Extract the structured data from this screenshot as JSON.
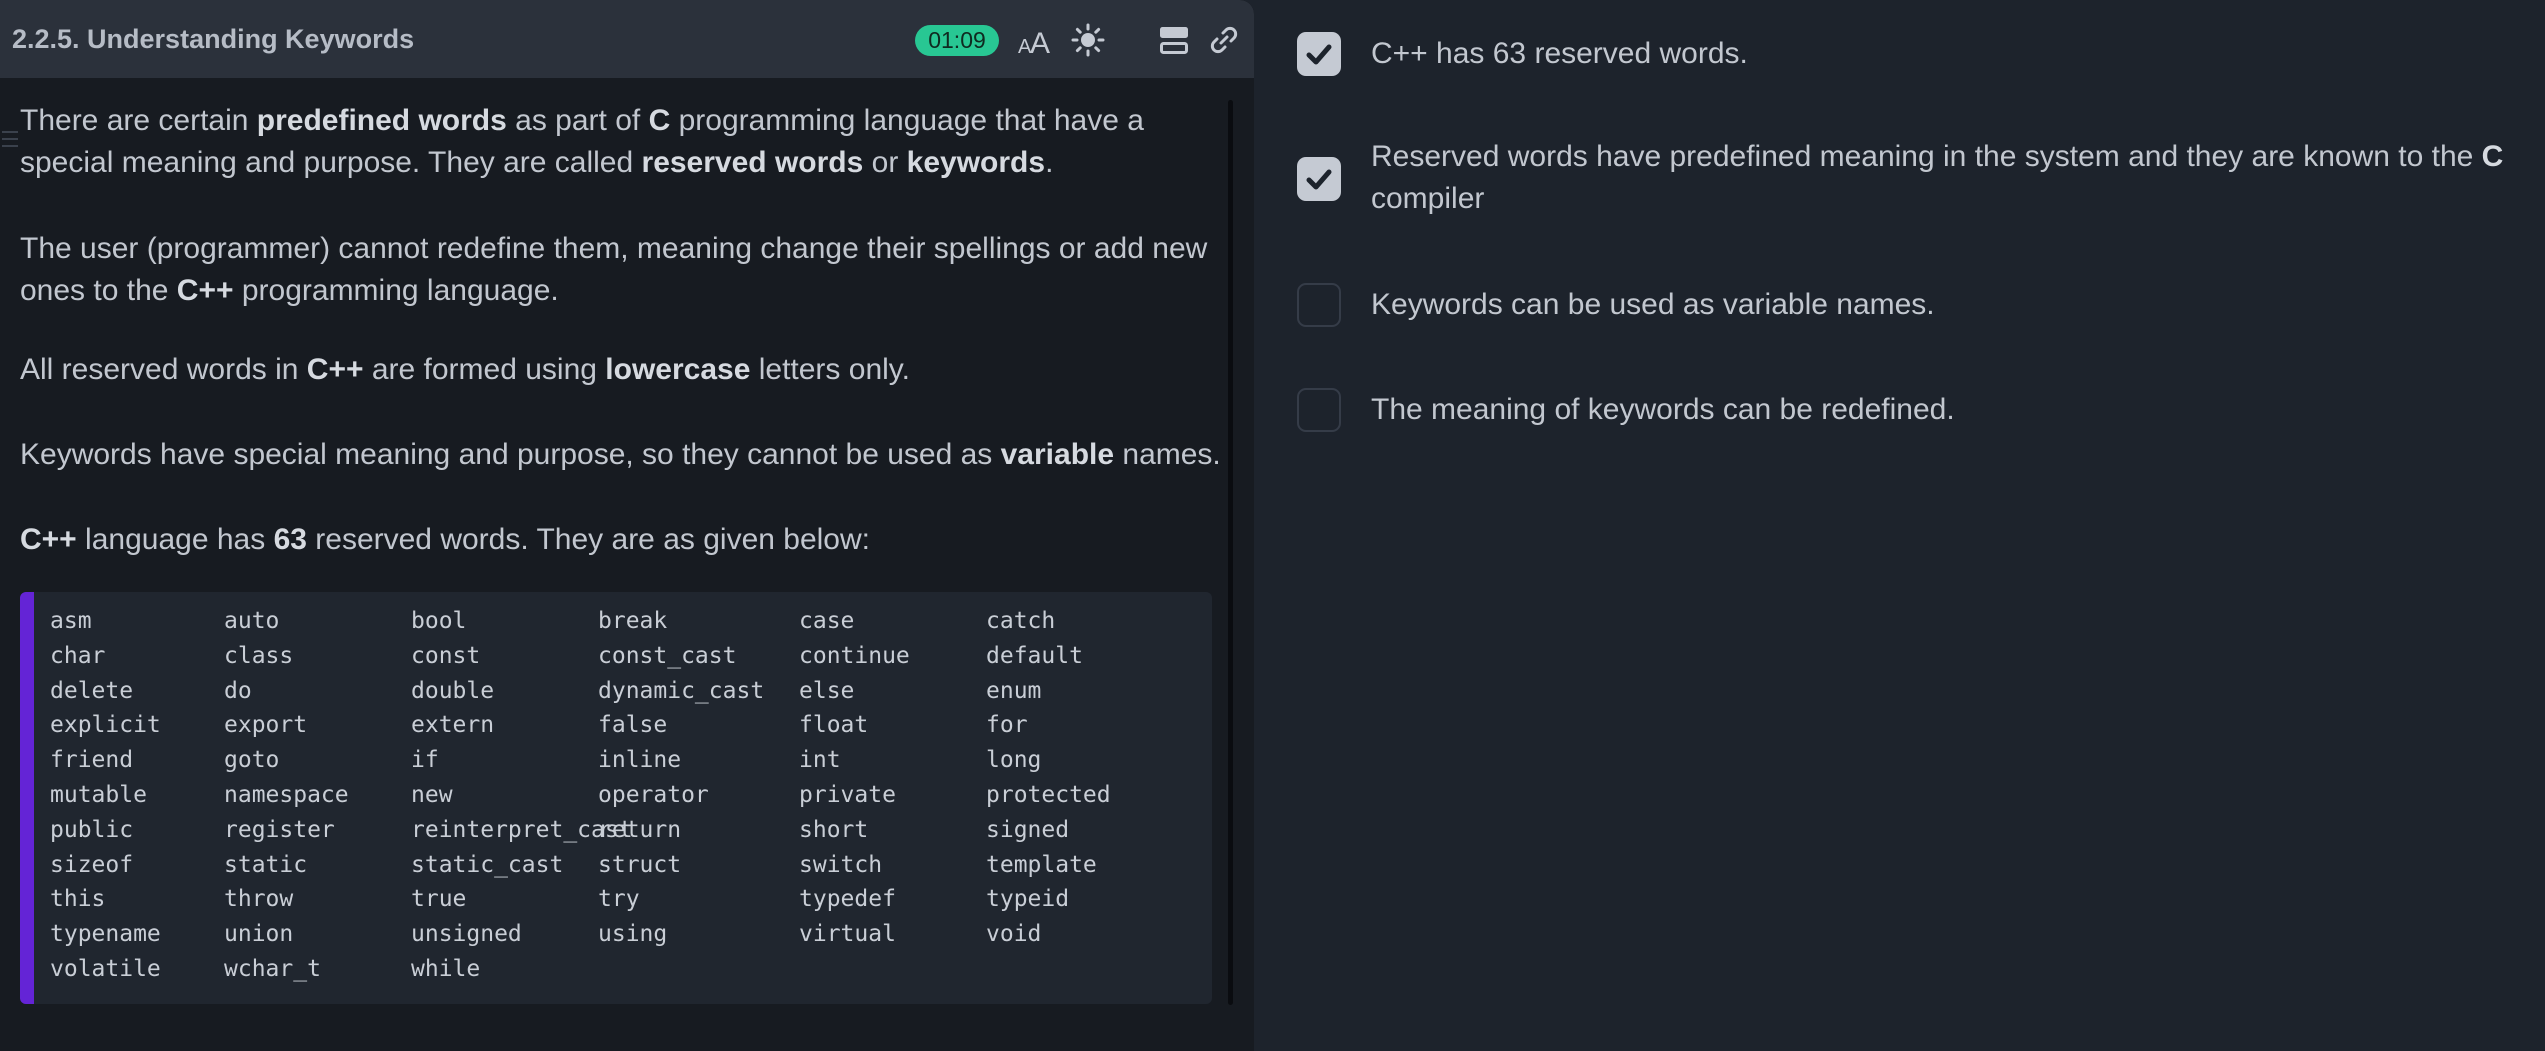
{
  "header": {
    "title": "2.2.5. Understanding Keywords",
    "timer": "01:09",
    "icons": [
      "font-size-icon",
      "theme-icon",
      "layout-icon",
      "link-icon"
    ]
  },
  "content": {
    "p1": [
      "There are certain ",
      "predefined words",
      " as part of ",
      "C",
      " programming language that have a special meaning and purpose. They are called ",
      "reserved words",
      " or ",
      "keywords",
      "."
    ],
    "p2": [
      "The user (programmer) cannot redefine them, meaning change their spellings or add new ones to the ",
      "C++",
      " programming language."
    ],
    "p3": [
      "All reserved words in ",
      "C++",
      " are formed using ",
      "lowercase",
      " letters only."
    ],
    "p4": [
      "Keywords have special meaning and purpose, so they cannot be used as ",
      "variable",
      " names."
    ],
    "p5": [
      "C++",
      " language has ",
      "63",
      " reserved words. They are as given below:"
    ]
  },
  "keywords": [
    [
      "asm",
      "auto",
      "bool",
      "break",
      "case",
      "catch"
    ],
    [
      "char",
      "class",
      "const",
      "const_cast",
      "continue",
      "default"
    ],
    [
      "delete",
      "do",
      "double",
      "dynamic_cast",
      "else",
      "enum"
    ],
    [
      "explicit",
      "export",
      "extern",
      "false",
      "float",
      "for"
    ],
    [
      "friend",
      "goto",
      "if",
      "inline",
      "int",
      "long"
    ],
    [
      "mutable",
      "namespace",
      "new",
      "operator",
      "private",
      "protected"
    ],
    [
      "public",
      "register",
      "reinterpret_cast",
      "return",
      "short",
      "signed"
    ],
    [
      "sizeof",
      "static",
      "static_cast",
      "struct",
      "switch",
      "template"
    ],
    [
      "this",
      "throw",
      "true",
      "try",
      "typedef",
      "typeid"
    ],
    [
      "typename",
      "union",
      "unsigned",
      "using",
      "virtual",
      "void"
    ],
    [
      "volatile",
      "wchar_t",
      "while"
    ]
  ],
  "options": [
    {
      "parts": [
        "C++ has 63 reserved words."
      ],
      "checked": true
    },
    {
      "parts": [
        "Reserved words have predefined meaning in the system and they are known to the ",
        "C",
        " compiler"
      ],
      "checked": true
    },
    {
      "parts": [
        "Keywords can be used as variable names."
      ],
      "checked": false
    },
    {
      "parts": [
        "The meaning of keywords can be redefined."
      ],
      "checked": false
    }
  ],
  "colors": {
    "accent": "#6424d6",
    "timer": "#28c793",
    "checked": "#c5cad3"
  }
}
